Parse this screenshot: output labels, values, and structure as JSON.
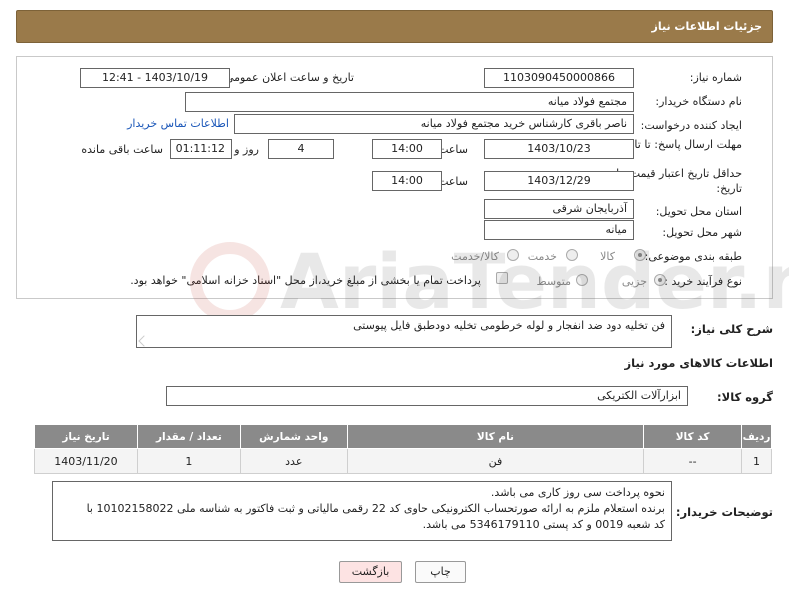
{
  "header": {
    "title": "جزئیات اطلاعات نیاز"
  },
  "form": {
    "need_number_label": "شماره نیاز:",
    "need_number": "1103090450000866",
    "announce_label": "تاریخ و ساعت اعلان عمومی:",
    "announce_value": "1403/10/19 - 12:41",
    "buyer_org_label": "نام دستگاه خریدار:",
    "buyer_org": "مجتمع فولاد میانه",
    "creator_label": "ایجاد کننده درخواست:",
    "creator": "ناصر باقری کارشناس خرید مجتمع فولاد میانه",
    "contact_link": "اطلاعات تماس خریدار",
    "deadline_label": "مهلت ارسال پاسخ: تا تاریخ:",
    "deadline_date": "1403/10/23",
    "time_label": "ساعت",
    "deadline_time": "14:00",
    "days_value": "4",
    "days_label": "روز و",
    "remaining_value": "01:11:12",
    "remaining_label": "ساعت باقی مانده",
    "validity_label": "حداقل تاریخ اعتبار قیمت: تا تاریخ:",
    "validity_date": "1403/12/29",
    "validity_time": "14:00",
    "province_label": "استان محل تحویل:",
    "province": "آذربایجان شرقی",
    "city_label": "شهر محل تحویل:",
    "city": "میانه",
    "category_label": "طبقه بندی موضوعی:",
    "category_options": [
      "کالا",
      "خدمت",
      "کالا/خدمت"
    ],
    "process_label": "نوع فرآیند خرید :",
    "process_options": [
      "جزیی",
      "متوسط"
    ],
    "payment_note": "پرداخت تمام یا بخشی از مبلغ خرید،از محل \"اسناد خزانه اسلامی\" خواهد بود."
  },
  "description": {
    "label": "شرح کلی نیاز:",
    "text": "فن تخلیه دود ضد انفجار و لوله خرطومی تخلیه دودطبق فایل پیوستی"
  },
  "goods_section": {
    "title": "اطلاعات کالاهای مورد نیاز",
    "group_label": "گروه کالا:",
    "group_value": "ابزارآلات الکتریکی"
  },
  "table": {
    "headers": [
      "ردیف",
      "کد کالا",
      "نام کالا",
      "واحد شمارش",
      "تعداد / مقدار",
      "تاریخ نیاز"
    ],
    "rows": [
      [
        "1",
        "--",
        "فن",
        "عدد",
        "1",
        "1403/11/20"
      ]
    ]
  },
  "buyer_notes": {
    "label": "توضیحات خریدار:",
    "lines": [
      "نحوه پرداخت سی روز کاری می باشد.",
      "برنده استعلام ملزم به ارائه صورتحساب الکترونیکی حاوی کد 22 رقمی مالیاتی و ثبت فاکتور به شناسه ملی 10102158022 با",
      "کد شعبه 0019 و کد پستی 5346179110 می باشد."
    ]
  },
  "buttons": {
    "print": "چاپ",
    "back": "بازگشت"
  },
  "colors": {
    "header": "#9a7a4a",
    "table_header": "#8a8a8a",
    "link": "#1a56b8",
    "back_button": "#fde3e3"
  }
}
